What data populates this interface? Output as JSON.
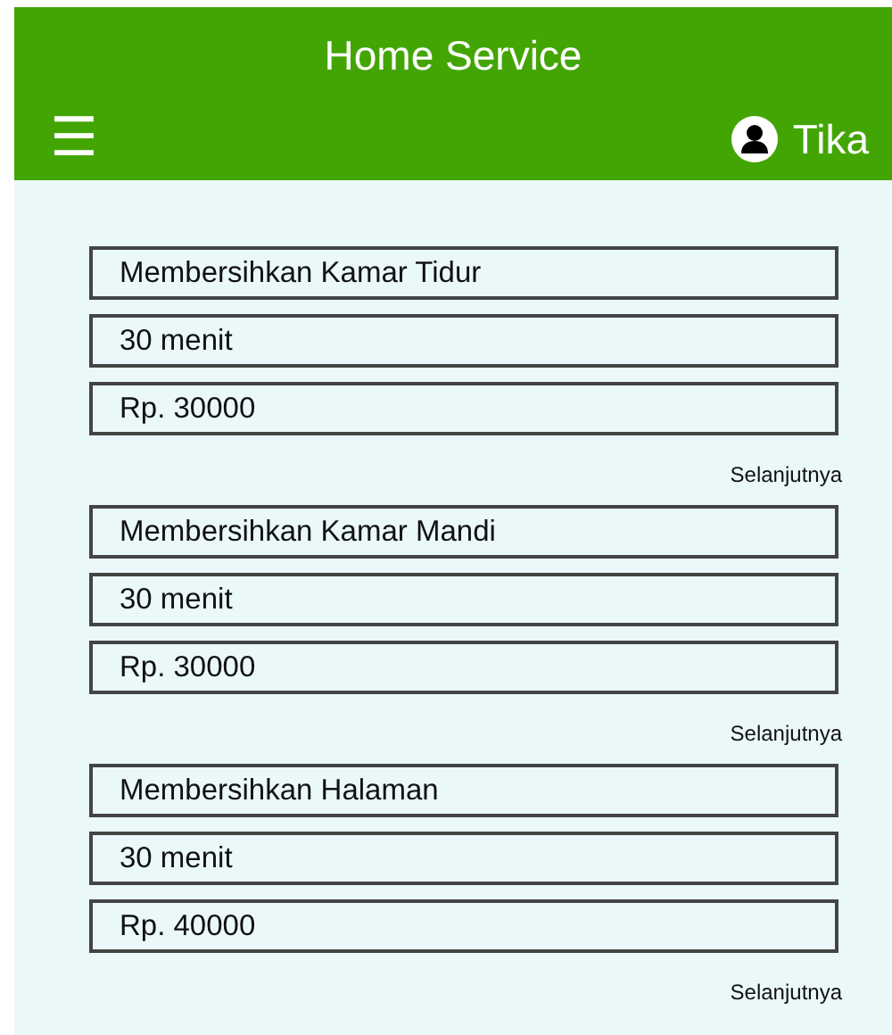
{
  "app_bar": {
    "title": "Home Service",
    "menu_icon": "☰",
    "user_name": "Tika"
  },
  "services": [
    {
      "name": "Membersihkan Kamar Tidur",
      "duration": "30 menit",
      "price": "Rp. 30000",
      "next_link": "Selanjutnya"
    },
    {
      "name": "Membersihkan Kamar Mandi",
      "duration": "30 menit",
      "price": "Rp. 30000",
      "next_link": "Selanjutnya"
    },
    {
      "name": "Membersihkan Halaman",
      "duration": "30 menit",
      "price": "Rp. 40000",
      "next_link": "Selanjutnya"
    }
  ]
}
